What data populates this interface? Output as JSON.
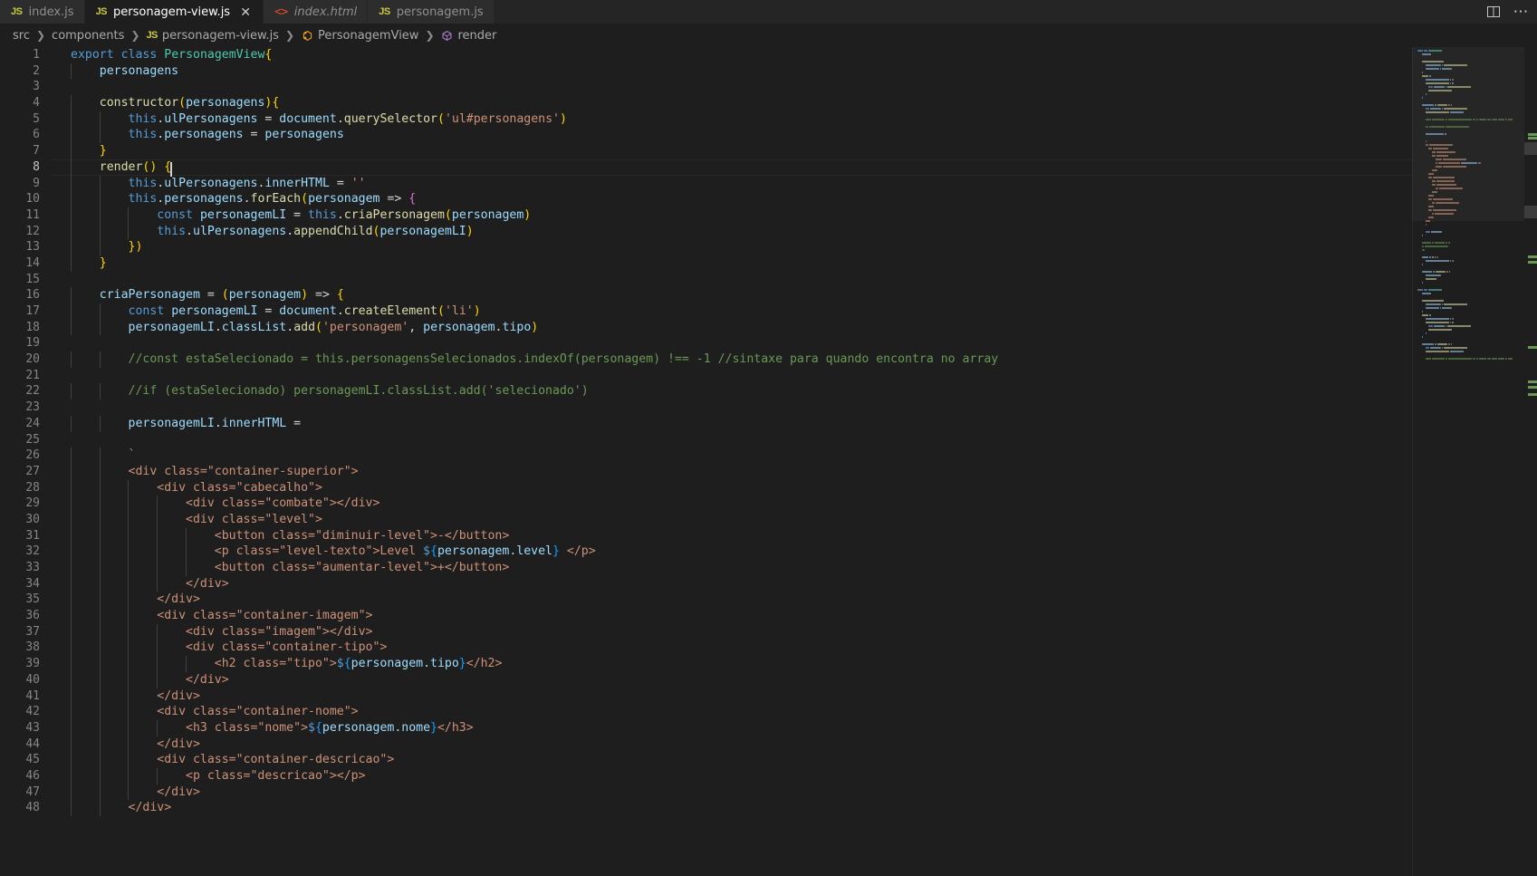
{
  "window": {
    "theme_bg": "#1e1e1e",
    "tabbar_bg": "#252526",
    "accent": "#007acc"
  },
  "tabbar": {
    "tabs": [
      {
        "label": "index.js",
        "icon": "js-file-icon",
        "icon_text": "JS",
        "active": false,
        "italic": false,
        "dirty": false
      },
      {
        "label": "personagem-view.js",
        "icon": "js-file-icon",
        "icon_text": "JS",
        "active": true,
        "italic": false,
        "dirty": false
      },
      {
        "label": "index.html",
        "icon": "html-file-icon",
        "icon_text": "<>",
        "active": false,
        "italic": true,
        "dirty": false
      },
      {
        "label": "personagem.js",
        "icon": "js-file-icon",
        "icon_text": "JS",
        "active": false,
        "italic": false,
        "dirty": false
      }
    ],
    "close_glyph": "✕",
    "actions": [
      {
        "name": "split-editor-icon",
        "glyph": "split"
      },
      {
        "name": "more-actions-icon",
        "glyph": "⋯"
      }
    ]
  },
  "breadcrumbs": {
    "separator": "❯",
    "items": [
      {
        "label": "src",
        "icon": null
      },
      {
        "label": "components",
        "icon": null
      },
      {
        "label": "personagem-view.js",
        "icon": "js-file-icon"
      },
      {
        "label": "PersonagemView",
        "icon": "class-symbol-icon"
      },
      {
        "label": "render",
        "icon": "method-symbol-icon"
      }
    ]
  },
  "editor": {
    "language": "javascript",
    "active_line": 8,
    "cursor": {
      "line": 8,
      "column": 13
    },
    "first_visible_line": 1,
    "last_visible_line": 48,
    "lines": [
      {
        "n": 1,
        "text": "export class PersonagemView{"
      },
      {
        "n": 2,
        "text": "    personagens"
      },
      {
        "n": 3,
        "text": ""
      },
      {
        "n": 4,
        "text": "    constructor(personagens){"
      },
      {
        "n": 5,
        "text": "        this.ulPersonagens = document.querySelector('ul#personagens')"
      },
      {
        "n": 6,
        "text": "        this.personagens = personagens"
      },
      {
        "n": 7,
        "text": "    }"
      },
      {
        "n": 8,
        "text": "    render() {"
      },
      {
        "n": 9,
        "text": "        this.ulPersonagens.innerHTML = ''"
      },
      {
        "n": 10,
        "text": "        this.personagens.forEach(personagem => {"
      },
      {
        "n": 11,
        "text": "            const personagemLI = this.criaPersonagem(personagem)"
      },
      {
        "n": 12,
        "text": "            this.ulPersonagens.appendChild(personagemLI)"
      },
      {
        "n": 13,
        "text": "        })"
      },
      {
        "n": 14,
        "text": "    }"
      },
      {
        "n": 15,
        "text": ""
      },
      {
        "n": 16,
        "text": "    criaPersonagem = (personagem) => {"
      },
      {
        "n": 17,
        "text": "        const personagemLI = document.createElement('li')"
      },
      {
        "n": 18,
        "text": "        personagemLI.classList.add('personagem', personagem.tipo)"
      },
      {
        "n": 19,
        "text": ""
      },
      {
        "n": 20,
        "text": "        //const estaSelecionado = this.personagensSelecionados.indexOf(personagem) !== -1 //sintaxe para quando encontra no array"
      },
      {
        "n": 21,
        "text": ""
      },
      {
        "n": 22,
        "text": "        //if (estaSelecionado) personagemLI.classList.add('selecionado')"
      },
      {
        "n": 23,
        "text": ""
      },
      {
        "n": 24,
        "text": "        personagemLI.innerHTML ="
      },
      {
        "n": 25,
        "text": ""
      },
      {
        "n": 26,
        "text": "        `"
      },
      {
        "n": 27,
        "text": "        <div class=\"container-superior\">"
      },
      {
        "n": 28,
        "text": "            <div class=\"cabecalho\">"
      },
      {
        "n": 29,
        "text": "                <div class=\"combate\"></div>"
      },
      {
        "n": 30,
        "text": "                <div class=\"level\">"
      },
      {
        "n": 31,
        "text": "                    <button class=\"diminuir-level\">-</button>"
      },
      {
        "n": 32,
        "text": "                    <p class=\"level-texto\">Level ${personagem.level} </p>"
      },
      {
        "n": 33,
        "text": "                    <button class=\"aumentar-level\">+</button>"
      },
      {
        "n": 34,
        "text": "                </div>"
      },
      {
        "n": 35,
        "text": "            </div>"
      },
      {
        "n": 36,
        "text": "            <div class=\"container-imagem\">"
      },
      {
        "n": 37,
        "text": "                <div class=\"imagem\"></div>"
      },
      {
        "n": 38,
        "text": "                <div class=\"container-tipo\">"
      },
      {
        "n": 39,
        "text": "                    <h2 class=\"tipo\">${personagem.tipo}</h2>"
      },
      {
        "n": 40,
        "text": "                </div>"
      },
      {
        "n": 41,
        "text": "            </div>"
      },
      {
        "n": 42,
        "text": "            <div class=\"container-nome\">"
      },
      {
        "n": 43,
        "text": "                <h3 class=\"nome\">${personagem.nome}</h3>"
      },
      {
        "n": 44,
        "text": "            </div>"
      },
      {
        "n": 45,
        "text": "            <div class=\"container-descricao\">"
      },
      {
        "n": 46,
        "text": "                <p class=\"descricao\"></p>"
      },
      {
        "n": 47,
        "text": "            </div>"
      },
      {
        "n": 48,
        "text": "        </div>"
      }
    ]
  },
  "colors": {
    "keyword": "#569cd6",
    "class_name": "#4ec9b0",
    "function": "#dcdcaa",
    "variable": "#9cdcfe",
    "string": "#ce9178",
    "comment": "#6a9955",
    "number": "#b5cea8",
    "bracket_1": "#ffd700",
    "bracket_2": "#da70d6",
    "bracket_3": "#179fff",
    "editor_bg": "#1e1e1e",
    "line_number": "#858585",
    "active_line_number": "#c6c6c6"
  }
}
